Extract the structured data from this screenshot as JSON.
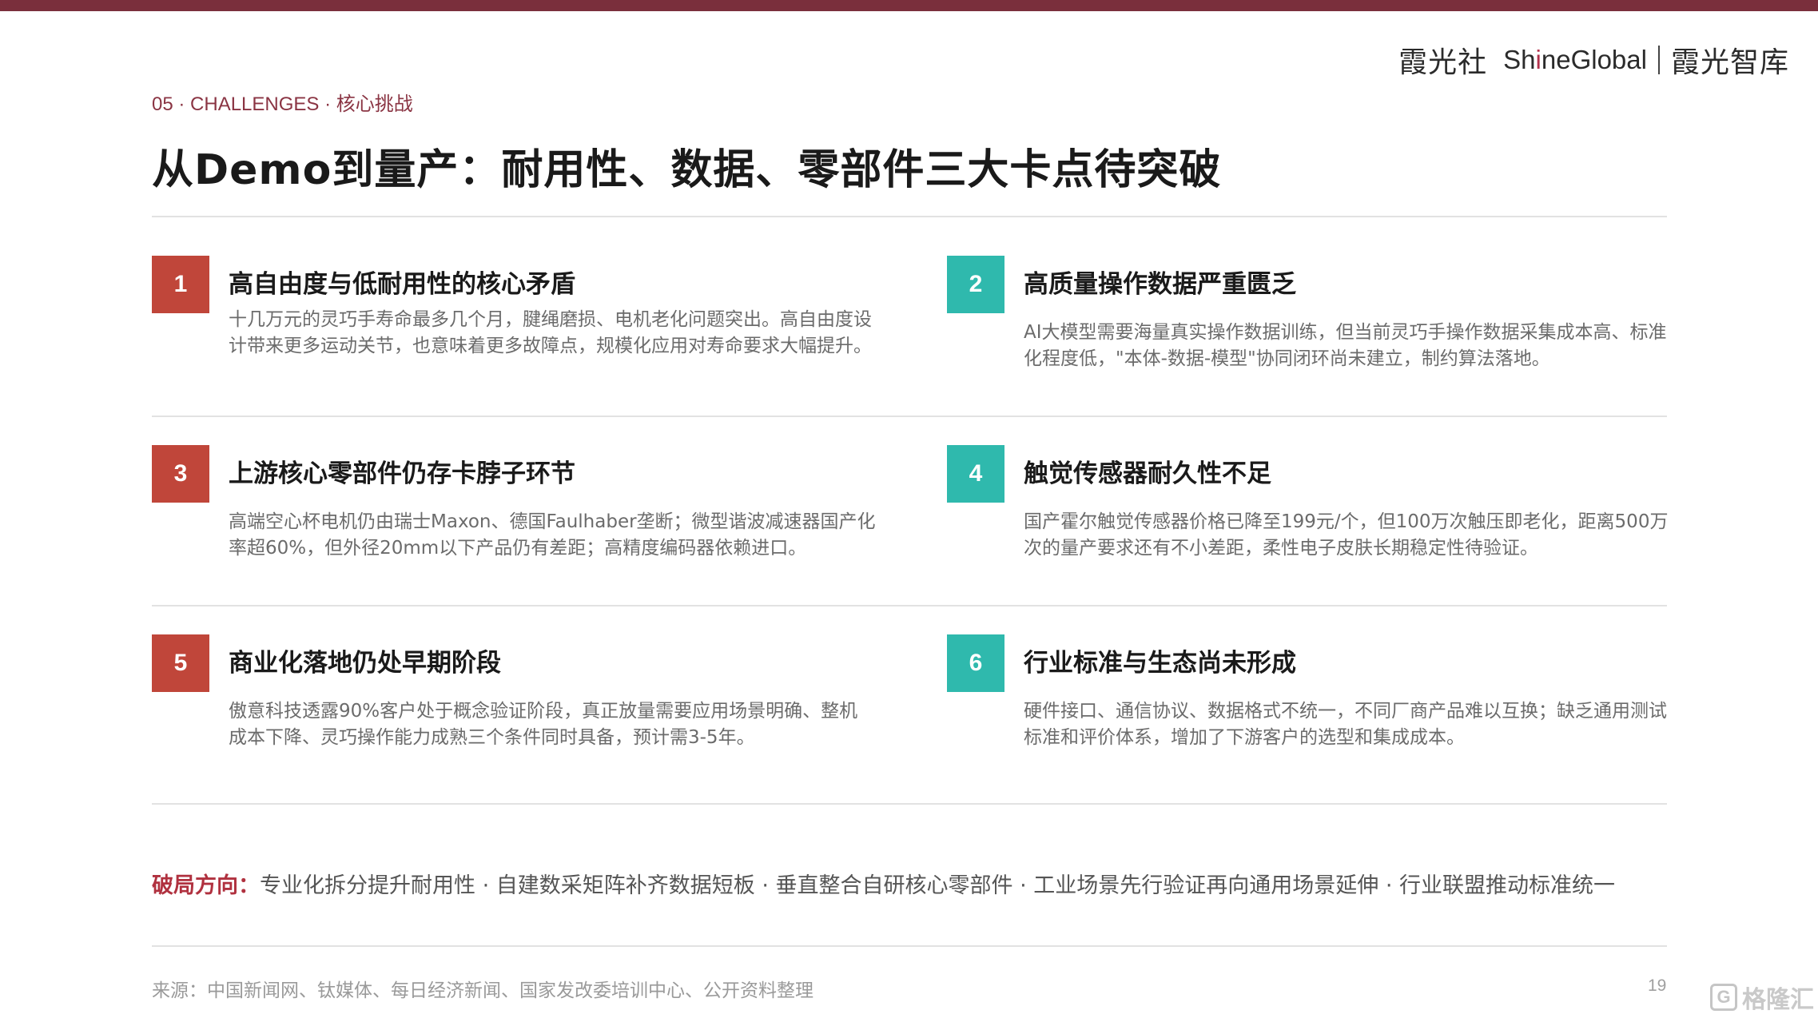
{
  "brand": {
    "name_cn": "霞光社",
    "name_en_pre": "Sh",
    "name_en_hi": "i",
    "name_en_post": "neGlobal",
    "sub_brand": "霞光智库"
  },
  "section": {
    "label": "05 · CHALLENGES · ",
    "label_cn": "核心挑战"
  },
  "title": "从Demo到量产：耐用性、数据、零部件三大卡点待突破",
  "items": [
    {
      "number": "1",
      "title": "高自由度与低耐用性的核心矛盾",
      "text": "十几万元的灵巧手寿命最多几个月，腱绳磨损、电机老化问题突出。高自由度设计带来更多运动关节，也意味着更多故障点，规模化应用对寿命要求大幅提升。",
      "color": "#c0463a"
    },
    {
      "number": "2",
      "title": "高质量操作数据严重匮乏",
      "text": "AI大模型需要海量真实操作数据训练，但当前灵巧手操作数据采集成本高、标准化程度低，\"本体-数据-模型\"协同闭环尚未建立，制约算法落地。",
      "color": "#2fb9ad"
    },
    {
      "number": "3",
      "title": "上游核心零部件仍存卡脖子环节",
      "text": "高端空心杯电机仍由瑞士Maxon、德国Faulhaber垄断；微型谐波减速器国产化率超60%，但外径20mm以下产品仍有差距；高精度编码器依赖进口。",
      "color": "#c0463a"
    },
    {
      "number": "4",
      "title": "触觉传感器耐久性不足",
      "text": "国产霍尔触觉传感器价格已降至199元/个，但100万次触压即老化，距离500万次的量产要求还有不小差距，柔性电子皮肤长期稳定性待验证。",
      "color": "#2fb9ad"
    },
    {
      "number": "5",
      "title": "商业化落地仍处早期阶段",
      "text": "傲意科技透露90%客户处于概念验证阶段，真正放量需要应用场景明确、整机成本下降、灵巧操作能力成熟三个条件同时具备，预计需3-5年。",
      "color": "#c0463a"
    },
    {
      "number": "6",
      "title": "行业标准与生态尚未形成",
      "text": "硬件接口、通信协议、数据格式不统一，不同厂商产品难以互换；缺乏通用测试标准和评价体系，增加了下游客户的选型和集成成本。",
      "color": "#2fb9ad"
    }
  ],
  "breakout": {
    "label": "破局方向：",
    "text": "专业化拆分提升耐用性 · 自建数采矩阵补齐数据短板 · 垂直整合自研核心零部件 · 工业场景先行验证再向通用场景延伸 · 行业联盟推动标准统一"
  },
  "source": "来源：中国新闻网、钛媒体、每日经济新闻、国家发改委培训中心、公开资料整理",
  "page_number": "19",
  "watermark": {
    "icon_letter": "G",
    "text": "格隆汇"
  },
  "colors": {
    "top_bar": "#7a2f3c",
    "accent_red": "#c0463a",
    "accent_teal": "#2fb9ad",
    "breakout_label": "#b0313f"
  }
}
